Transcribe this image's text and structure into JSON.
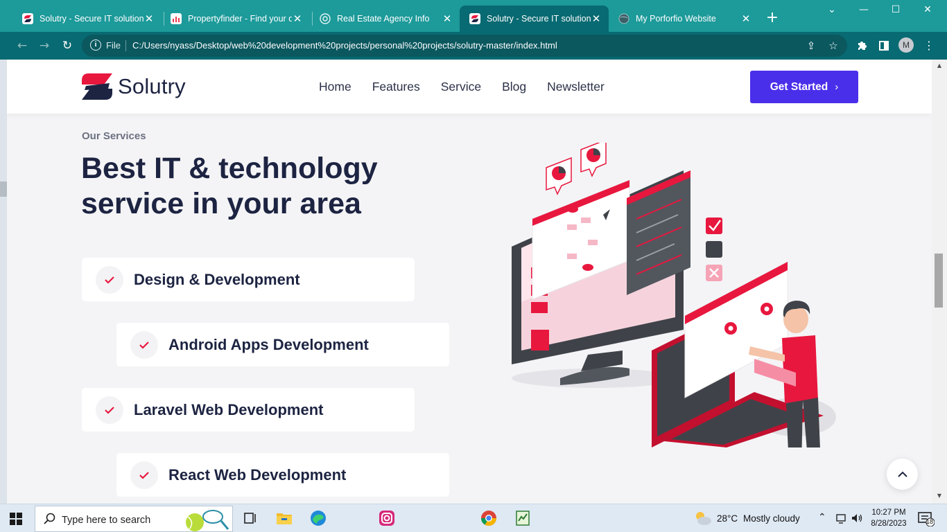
{
  "browser": {
    "tabs": [
      {
        "title": "Solutry - Secure IT solutions",
        "active": false
      },
      {
        "title": "Propertyfinder - Find your dream",
        "active": false
      },
      {
        "title": "Real Estate Agency Info",
        "active": false
      },
      {
        "title": "Solutry - Secure IT solutions",
        "active": true
      },
      {
        "title": "My Porforfio Website",
        "active": false
      }
    ],
    "omnibox": {
      "scheme_label": "File",
      "url": "C:/Users/nyass/Desktop/web%20development%20projects/personal%20projects/solutry-master/index.html"
    },
    "profile_initial": "M"
  },
  "site": {
    "brand": "Solutry",
    "nav": [
      "Home",
      "Features",
      "Service",
      "Blog",
      "Newsletter"
    ],
    "cta_label": "Get Started",
    "eyebrow": "Our Services",
    "headline_line1": "Best IT & technology",
    "headline_line2": "service in your area",
    "services": [
      "Design & Development",
      "Android Apps Development",
      "Laravel Web Development",
      "React Web Development"
    ],
    "colors": {
      "brand_red": "#e8173e",
      "brand_navy": "#1d2442",
      "cta_purple": "#4a2fea"
    }
  },
  "taskbar": {
    "search_placeholder": "Type here to search",
    "weather_temp": "28°C",
    "weather_desc": "Mostly cloudy",
    "time": "10:27 PM",
    "date": "8/28/2023",
    "notification_count": "18"
  }
}
